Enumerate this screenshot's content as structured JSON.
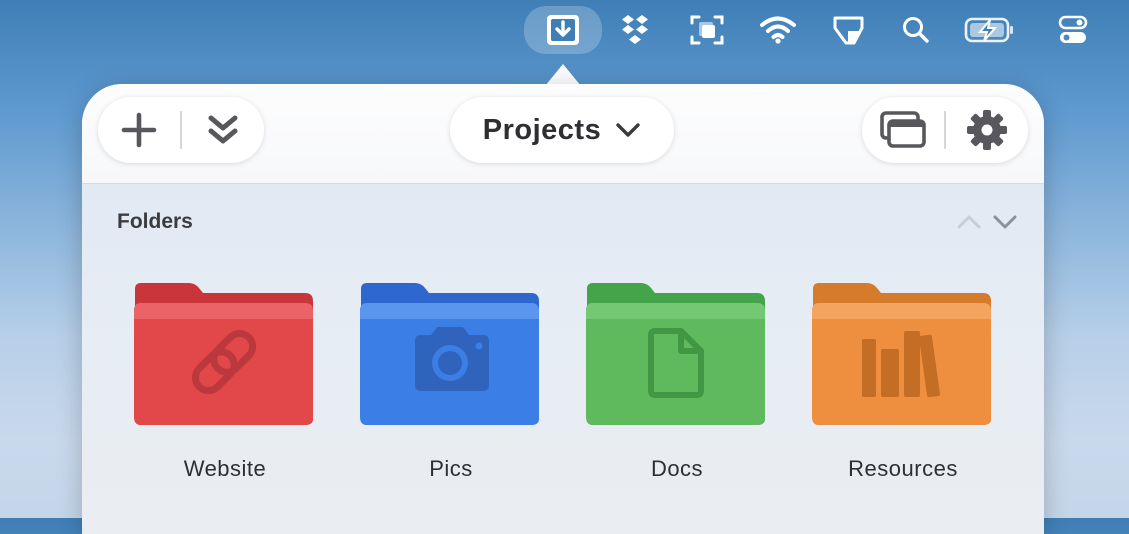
{
  "menubar": {
    "icons": [
      "download-icon",
      "dropbox-icon",
      "screen-capture-icon",
      "wifi-icon",
      "tag-icon",
      "search-icon",
      "battery-charging-icon",
      "control-center-icon"
    ]
  },
  "toolbar": {
    "project_selector": "Projects",
    "left_buttons": [
      "plus-icon",
      "collapse-icon"
    ],
    "right_buttons": [
      "windows-icon",
      "gear-icon"
    ]
  },
  "section": {
    "title": "Folders"
  },
  "folders": [
    {
      "label": "Website",
      "color": "#e2474a",
      "icon": "link-icon"
    },
    {
      "label": "Pics",
      "color": "#3b7fe6",
      "icon": "camera-icon"
    },
    {
      "label": "Docs",
      "color": "#5fba5e",
      "icon": "document-icon"
    },
    {
      "label": "Resources",
      "color": "#ee8f3f",
      "icon": "books-icon"
    }
  ]
}
